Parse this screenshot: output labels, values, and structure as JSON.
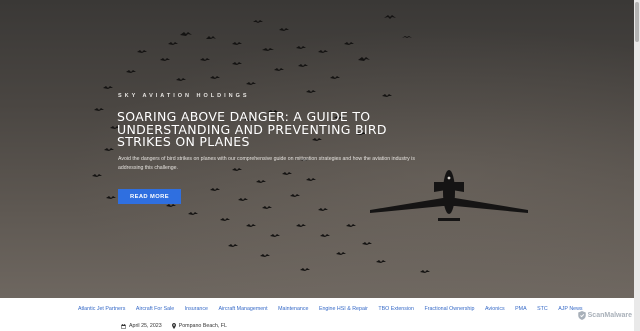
{
  "hero": {
    "eyebrow": "SKY AVIATION HOLDINGS",
    "headline": "SOARING ABOVE DANGER: A GUIDE TO UNDERSTANDING AND PREVENTING BIRD STRIKES ON PLANES",
    "subtext": "Avoid the dangers of bird strikes on planes with our comprehensive guide on mitigation strategies and how the aviation industry is addressing this challenge.",
    "cta_label": "READ MORE"
  },
  "nav": {
    "items": [
      "Atlantic Jet Partners",
      "Aircraft For Sale",
      "Insurance",
      "Aircraft Management",
      "Maintenance",
      "Engine HSI & Repair",
      "TBO Extension",
      "Fractional Ownership",
      "Avionics",
      "PMA",
      "STC",
      "AJP News"
    ]
  },
  "meta": {
    "date": "April 25, 2023",
    "location": "Pompano Beach, FL"
  },
  "badge": {
    "label": "ScanMalware"
  },
  "colors": {
    "accent": "#2f6fe0",
    "link": "#3569c7"
  },
  "icons": [
    "calendar-icon",
    "map-pin-icon",
    "shield-icon"
  ]
}
